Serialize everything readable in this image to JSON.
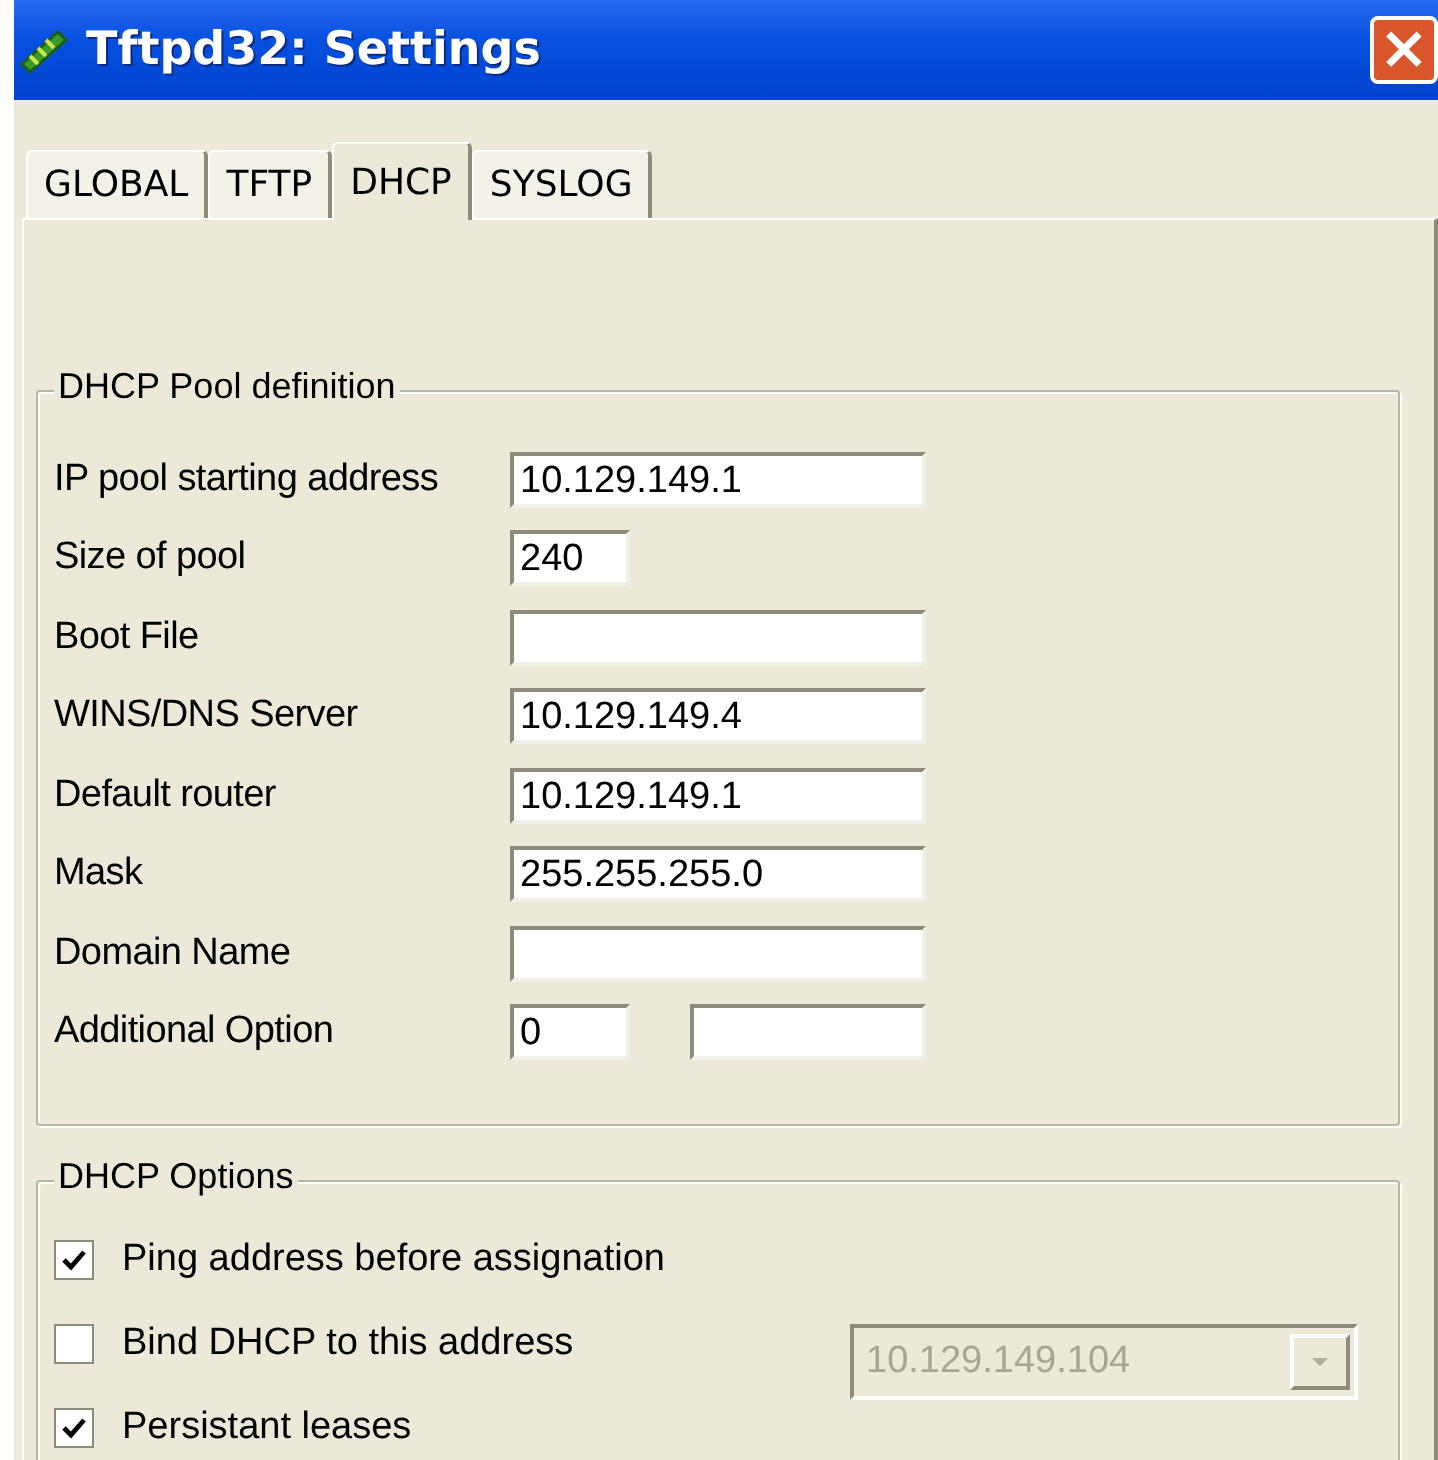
{
  "window": {
    "title": "Tftpd32: Settings",
    "close": "×"
  },
  "tabs": [
    {
      "label": "GLOBAL",
      "selected": false
    },
    {
      "label": "TFTP",
      "selected": false
    },
    {
      "label": "DHCP",
      "selected": true
    },
    {
      "label": "SYSLOG",
      "selected": false
    }
  ],
  "pool": {
    "title": "DHCP Pool definition",
    "rows": [
      {
        "label": "IP pool starting address",
        "kind": "wide",
        "value": "10.129.149.1"
      },
      {
        "label": "Size of pool",
        "kind": "short",
        "value": "240"
      },
      {
        "label": "Boot File",
        "kind": "wide"
      },
      {
        "label": "WINS/DNS Server",
        "kind": "wide",
        "value": "10.129.149.4"
      },
      {
        "label": "Default router",
        "kind": "wide",
        "value": "10.129.149.1"
      },
      {
        "label": "Mask",
        "kind": "wide",
        "value": "255.255.255.0"
      },
      {
        "label": "Domain Name",
        "kind": "wide"
      },
      {
        "label": "Additional Option",
        "kind": "pair",
        "value": "0"
      }
    ]
  },
  "options": {
    "title": "DHCP Options",
    "items": [
      {
        "label": "Ping address before assignation",
        "checked": true
      },
      {
        "label": "Bind DHCP to this address",
        "checked": false,
        "combo": {
          "value": "10.129.149.104",
          "disabled": true
        }
      },
      {
        "label": "Persistant leases",
        "checked": true
      }
    ]
  }
}
